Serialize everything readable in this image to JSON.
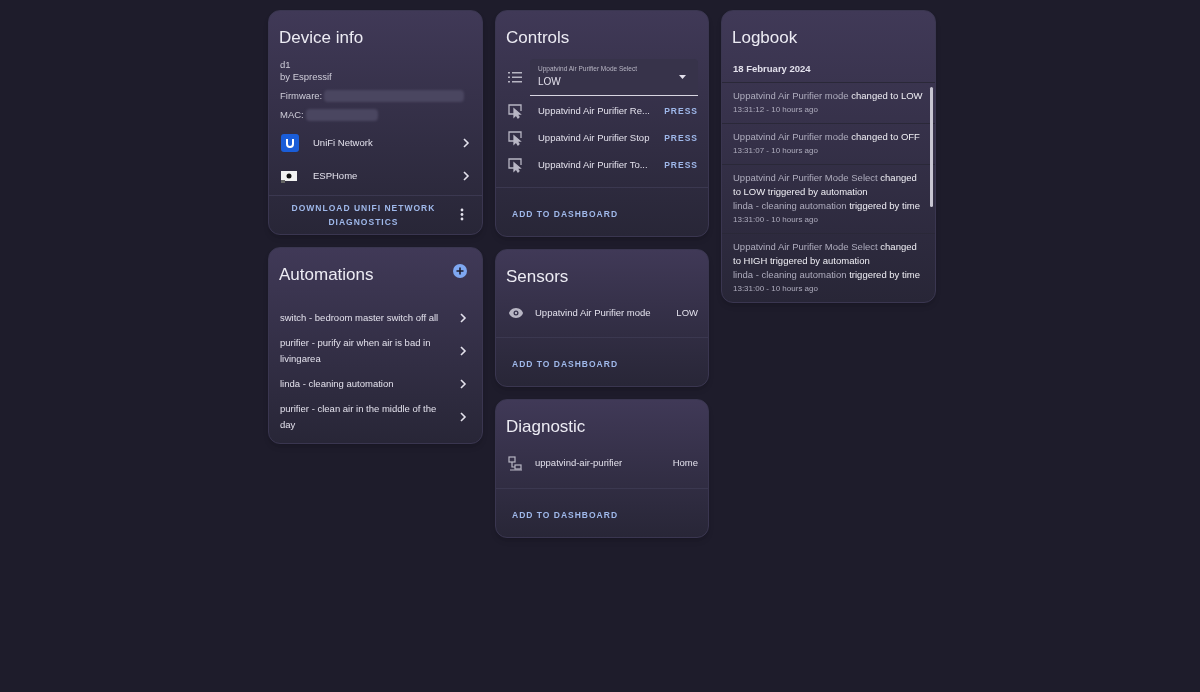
{
  "device_info": {
    "title": "Device info",
    "name": "d1",
    "manufacturer": "by Espressif",
    "firmware_label": "Firmware:",
    "mac_label": "MAC:",
    "integrations": [
      {
        "kind": "unifi",
        "label": "UniFi Network"
      },
      {
        "kind": "esphome",
        "label": "ESPHome"
      }
    ],
    "action": "DOWNLOAD UNIFI NETWORK DIAGNOSTICS"
  },
  "automations": {
    "title": "Automations",
    "items": [
      "switch - bedroom master switch off all",
      "purifier - purify air when air is bad in livingarea",
      "linda - cleaning automation",
      "purifier - clean air in the middle of the day"
    ]
  },
  "controls": {
    "title": "Controls",
    "select": {
      "label": "Uppatvind Air Purifier Mode Select",
      "value": "LOW"
    },
    "buttons": [
      {
        "label": "Uppatvind Air Purifier Re...",
        "action": "PRESS"
      },
      {
        "label": "Uppatvind Air Purifier Stop",
        "action": "PRESS"
      },
      {
        "label": "Uppatvind Air Purifier To...",
        "action": "PRESS"
      }
    ],
    "add": "ADD TO DASHBOARD"
  },
  "sensors": {
    "title": "Sensors",
    "rows": [
      {
        "kind": "eye",
        "label": "Uppatvind Air Purifier mode",
        "value": "LOW"
      }
    ],
    "add": "ADD TO DASHBOARD"
  },
  "diagnostic": {
    "title": "Diagnostic",
    "rows": [
      {
        "kind": "network",
        "label": "uppatvind-air-purifier",
        "value": "Home"
      }
    ],
    "add": "ADD TO DASHBOARD"
  },
  "logbook": {
    "title": "Logbook",
    "date": "18 February 2024",
    "entries": [
      {
        "entity": "Uppatvind Air Purifier mode",
        "message": "changed to LOW",
        "time": "13:31:12 - 10 hours ago"
      },
      {
        "entity": "Uppatvind Air Purifier mode",
        "message": "changed to OFF",
        "time": "13:31:07 - 10 hours ago"
      },
      {
        "entity": "Uppatvind Air Purifier Mode Select",
        "message": "changed to LOW triggered by automation",
        "context_entity": "linda - cleaning automation",
        "context_message": "triggered by time",
        "time": "13:31:00 - 10 hours ago"
      },
      {
        "entity": "Uppatvind Air Purifier Mode Select",
        "message": "changed to HIGH triggered by automation",
        "context_entity": "linda - cleaning automation",
        "context_message": "triggered by time",
        "time": "13:31:00 - 10 hours ago"
      }
    ]
  }
}
